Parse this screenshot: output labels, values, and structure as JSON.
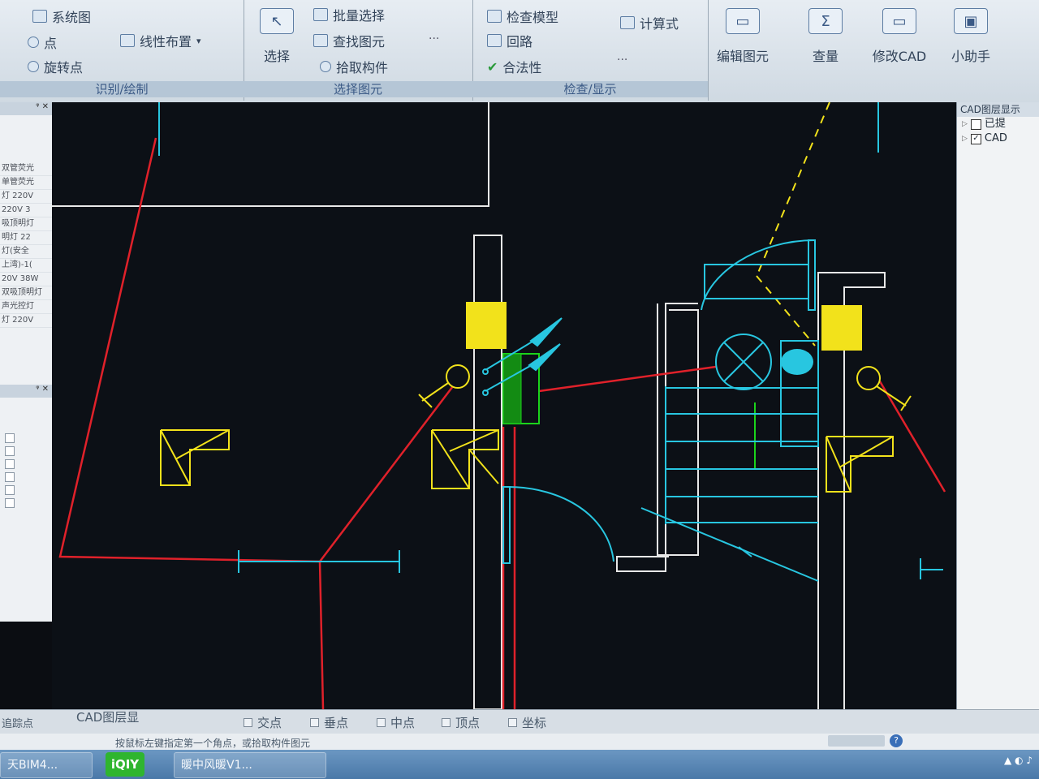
{
  "ribbon": {
    "g1": {
      "caption": "识别/绘制",
      "items": [
        "系统图",
        "点",
        "线性布置",
        "旋转点"
      ]
    },
    "g2": {
      "caption": "选择图元",
      "select_label": "选择",
      "items": [
        "批量选择",
        "查找图元",
        "拾取构件"
      ],
      "more": "···"
    },
    "g3": {
      "caption": "检查/显示",
      "items": [
        "检查模型",
        "回路",
        "合法性",
        "计算式"
      ],
      "more": "···"
    },
    "buttons": [
      "编辑图元",
      "查量",
      "修改CAD",
      "小助手"
    ]
  },
  "left_panel": {
    "rows": [
      "双管荧光",
      "单管荧光",
      "灯 220V",
      "220V 3",
      "吸顶明灯",
      "明灯 22",
      "灯(安全",
      "上湾)-1(",
      "20V 38W",
      "双吸顶明灯",
      "声光控灯",
      "灯 220V"
    ],
    "bottom_label": "追踪点"
  },
  "right_panel": {
    "title": "CAD图层显示",
    "rows": [
      "已提",
      "CAD"
    ]
  },
  "snap": {
    "cad_layer": "CAD图层显",
    "items": [
      "交点",
      "垂点",
      "中点",
      "顶点",
      "坐标"
    ]
  },
  "status": {
    "message": "按鼠标左键指定第一个角点，或拾取构件图元"
  },
  "taskbar": {
    "app1": "天BIM4...",
    "iqiyi": "iQIY",
    "app3": "暖中风暖V1..."
  },
  "colors": {
    "canvas_bg": "#0c1016",
    "wall": "#e8e8e8",
    "red_line": "#e0212a",
    "yellow": "#f2e21b",
    "cyan": "#28c6e0",
    "green": "#1bd41b"
  }
}
